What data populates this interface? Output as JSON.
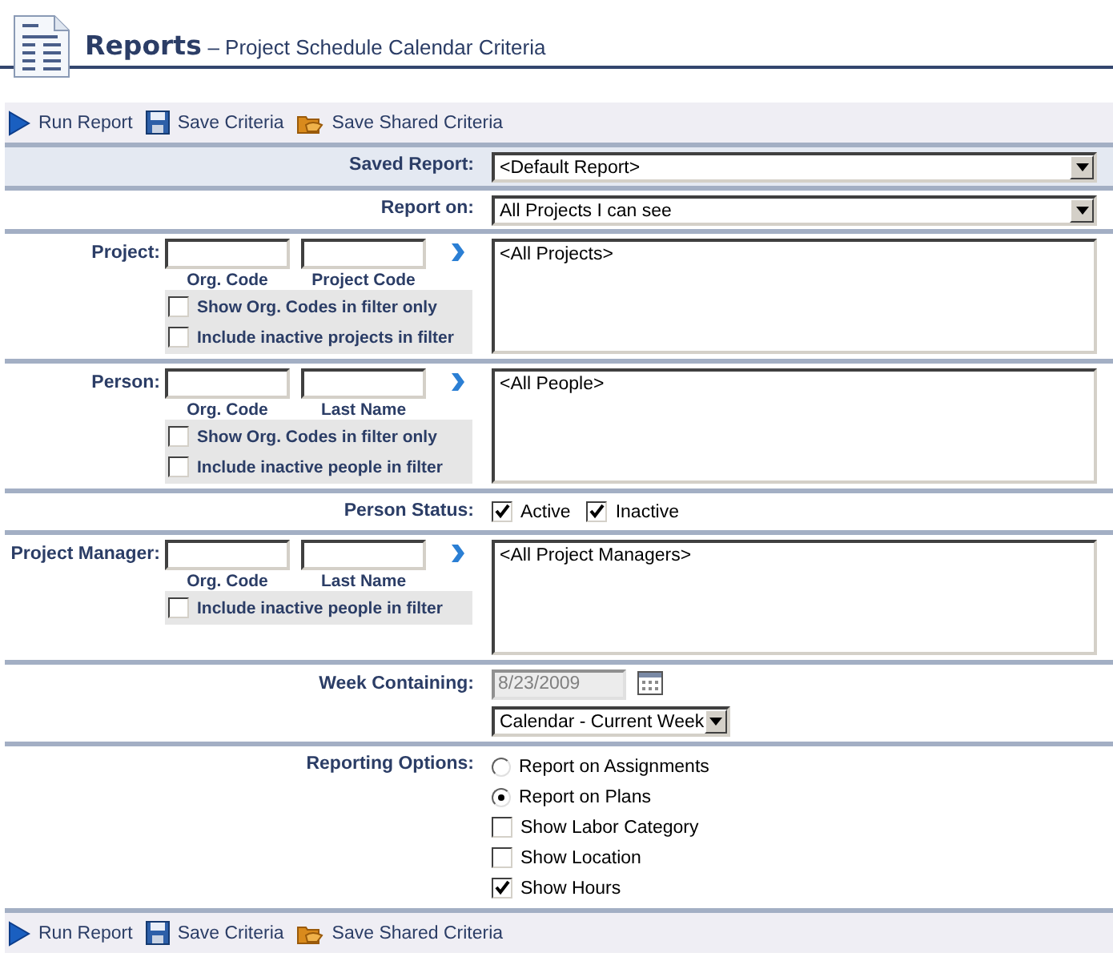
{
  "header": {
    "title": "Reports",
    "subtitle": "– Project Schedule Calendar Criteria"
  },
  "toolbar_top": [
    {
      "kind": "run",
      "label": "Run Report"
    },
    {
      "kind": "save",
      "label": "Save Criteria"
    },
    {
      "kind": "shared",
      "label": "Save Shared Criteria"
    }
  ],
  "rows": [
    {
      "kind": "select",
      "label": "Saved Report:",
      "value": "<Default Report>",
      "shaded": true
    },
    {
      "kind": "select",
      "label": "Report on:",
      "value": "All Projects I can see",
      "shaded": false
    },
    {
      "kind": "filter",
      "label": "Project:",
      "inputs": [
        {
          "caption": "Org. Code"
        },
        {
          "caption": "Project Code"
        }
      ],
      "options": [
        {
          "label": "Show Org. Codes in filter only",
          "checked": false
        },
        {
          "label": "Include inactive projects in filter",
          "checked": false
        }
      ],
      "list": "<All Projects>"
    },
    {
      "kind": "filter",
      "label": "Person:",
      "inputs": [
        {
          "caption": "Org. Code"
        },
        {
          "caption": "Last Name"
        }
      ],
      "options": [
        {
          "label": "Show Org. Codes in filter only",
          "checked": false
        },
        {
          "label": "Include inactive people in filter",
          "checked": false
        }
      ],
      "list": "<All People>"
    },
    {
      "kind": "checks",
      "label": "Person Status:",
      "items": [
        {
          "label": "Active",
          "checked": true
        },
        {
          "label": "Inactive",
          "checked": true
        }
      ]
    },
    {
      "kind": "filter",
      "label": "Project Manager:",
      "inputs": [
        {
          "caption": "Org. Code"
        },
        {
          "caption": "Last Name"
        }
      ],
      "options": [
        {
          "label": "Include inactive people in filter",
          "checked": false
        }
      ],
      "list": "<All Project Managers>"
    },
    {
      "kind": "week",
      "label": "Week Containing:",
      "date": "8/23/2009",
      "disabled": true,
      "period": "Calendar - Current Week"
    },
    {
      "kind": "options",
      "label": "Reporting Options:",
      "items": [
        {
          "kind": "radio",
          "label": "Report on Assignments",
          "selected": false
        },
        {
          "kind": "radio",
          "label": "Report on Plans",
          "selected": true
        },
        {
          "kind": "checkbox",
          "label": "Show Labor Category",
          "checked": false
        },
        {
          "kind": "checkbox",
          "label": "Show Location",
          "checked": false
        },
        {
          "kind": "checkbox",
          "label": "Show Hours",
          "checked": true
        }
      ]
    }
  ],
  "toolbar_bottom": [
    {
      "kind": "run",
      "label": "Run Report"
    },
    {
      "kind": "save",
      "label": "Save Criteria"
    },
    {
      "kind": "shared",
      "label": "Save Shared Criteria"
    }
  ]
}
